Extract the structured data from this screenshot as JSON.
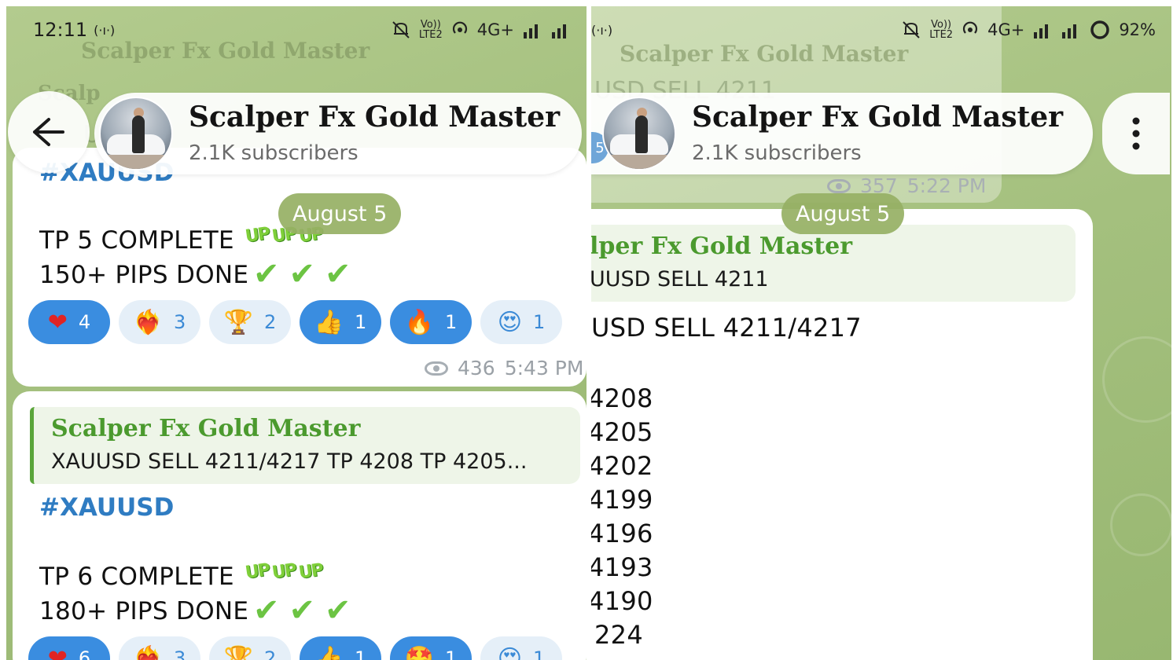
{
  "status_bar": {
    "time": "12:11",
    "signal_text": "(·ı·)",
    "volte": "Vo))\nLTE2",
    "network": "4G+",
    "battery": "92%"
  },
  "channel": {
    "name": "Scalper Fx Gold Master",
    "subscribers": "2.1K subscribers",
    "ghost_name": "Scalper Fx Gold Master",
    "ghost_left": "U",
    "ghost_right": "USD SELL 4211",
    "ghost_right_badge": "5"
  },
  "date_chip": "August 5",
  "left": {
    "msg1": {
      "hashtag_partial": "#XAUUSD",
      "line1": "TP 5 COMPLETE",
      "line2": "150+ PIPS DONE",
      "up_stickers": [
        "UP",
        "UP",
        "UP"
      ],
      "reactions": [
        {
          "emoji": "❤",
          "count": "4",
          "active": true
        },
        {
          "emoji": "❤‍🔥",
          "count": "3",
          "active": false
        },
        {
          "emoji": "🏆",
          "count": "2",
          "active": false
        },
        {
          "emoji": "👍",
          "count": "1",
          "active": true
        },
        {
          "emoji": "🔥",
          "count": "1",
          "active": true
        },
        {
          "emoji": "😍",
          "count": "1",
          "active": false
        }
      ],
      "views": "436",
      "time": "5:43 PM"
    },
    "msg2": {
      "reply_name": "Scalper Fx Gold Master",
      "reply_text": "XAUUSD SELL 4211/4217  TP 4208 TP 4205...",
      "hashtag": "#XAUUSD",
      "line1": "TP 6 COMPLETE",
      "line2": "180+ PIPS DONE",
      "reactions": [
        {
          "emoji": "❤",
          "count": "6",
          "active": true
        },
        {
          "emoji": "❤‍🔥",
          "count": "3",
          "active": false
        },
        {
          "emoji": "🏆",
          "count": "2",
          "active": false
        },
        {
          "emoji": "👍",
          "count": "1",
          "active": true
        },
        {
          "emoji": "🤩",
          "count": "1",
          "active": true
        },
        {
          "emoji": "😍",
          "count": "1",
          "active": false
        }
      ]
    }
  },
  "right": {
    "prev_meta": {
      "views": "357",
      "time": "5:22 PM"
    },
    "msg": {
      "reply_name": "lper Fx Gold Master",
      "reply_text": "UUSD SELL 4211",
      "main_line": "USD SELL 4211/4217",
      "tp_lines": [
        "4208",
        "4205",
        "4202",
        "4199",
        "4196",
        "4193",
        "4190",
        "224"
      ]
    }
  },
  "colors": {
    "accent_blue": "#3a8de0",
    "hashtag_blue": "#2f7cc2",
    "reply_green": "#4b9a2e",
    "chat_background": "#a4c07e",
    "date_chip": "#96b064"
  },
  "icons": {
    "back": "back-arrow-icon",
    "menu": "more-vertical-icon",
    "views": "eye-icon",
    "mute": "bell-off-icon",
    "hotspot": "hotspot-icon",
    "signal": "signal-bars-icon",
    "battery": "battery-ring-icon"
  }
}
